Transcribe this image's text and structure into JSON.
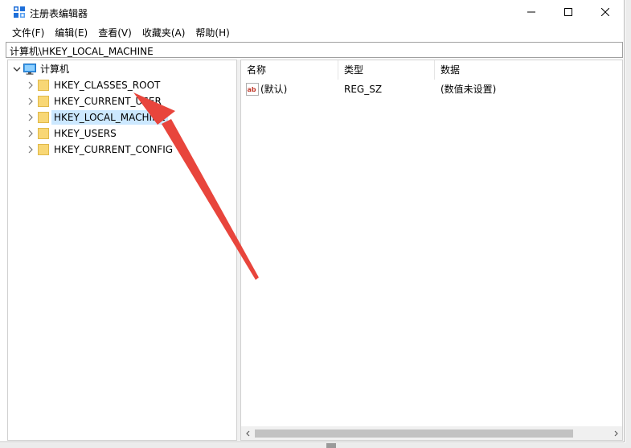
{
  "window": {
    "title": "注册表编辑器",
    "controls": {
      "minimize": "minimize-icon",
      "maximize": "maximize-icon",
      "close": "close-icon"
    }
  },
  "menu": [
    {
      "label": "文件(F)"
    },
    {
      "label": "编辑(E)"
    },
    {
      "label": "查看(V)"
    },
    {
      "label": "收藏夹(A)"
    },
    {
      "label": "帮助(H)"
    }
  ],
  "address": {
    "path": "计算机\\HKEY_LOCAL_MACHINE"
  },
  "tree": {
    "root": {
      "label": "计算机",
      "icon": "computer-icon",
      "expanded": true
    },
    "children": [
      {
        "label": "HKEY_CLASSES_ROOT",
        "selected": false
      },
      {
        "label": "HKEY_CURRENT_USER",
        "selected": false
      },
      {
        "label": "HKEY_LOCAL_MACHINE",
        "selected": true
      },
      {
        "label": "HKEY_USERS",
        "selected": false
      },
      {
        "label": "HKEY_CURRENT_CONFIG",
        "selected": false
      }
    ]
  },
  "list": {
    "columns": [
      {
        "label": "名称"
      },
      {
        "label": "类型"
      },
      {
        "label": "数据"
      }
    ],
    "rows": [
      {
        "name": "(默认)",
        "type": "REG_SZ",
        "data": "(数值未设置)",
        "icon": "string-value-icon"
      }
    ]
  },
  "edge": {
    "left_top": "2",
    "left_bottom": "f"
  },
  "colors": {
    "selection": "#cce8ff",
    "annotation_arrow": "#e8453c",
    "folder": "#f8d775",
    "app_icon": "#1e6fd9"
  }
}
